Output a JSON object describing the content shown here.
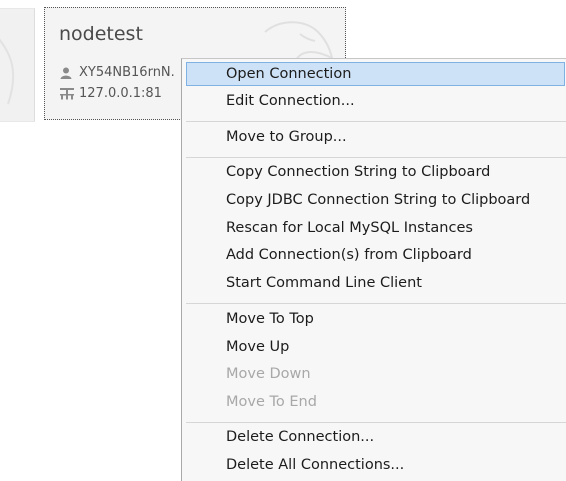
{
  "connection_tile": {
    "name": "nodetest",
    "user": "XY54NB16rnN.",
    "host": "127.0.0.1:81"
  },
  "context_menu": {
    "open_connection": "Open Connection",
    "edit_connection": "Edit Connection...",
    "move_to_group": "Move to Group...",
    "copy_connection_string": "Copy Connection String to Clipboard",
    "copy_jdbc_string": "Copy JDBC Connection String to Clipboard",
    "rescan_local": "Rescan for Local MySQL Instances",
    "add_from_clipboard": "Add Connection(s) from Clipboard",
    "start_cli": "Start Command Line Client",
    "move_to_top": "Move To Top",
    "move_up": "Move Up",
    "move_down": "Move Down",
    "move_to_end": "Move To End",
    "delete_connection": "Delete Connection...",
    "delete_all": "Delete All Connections..."
  },
  "icons": {
    "user": "user-icon",
    "host": "network-icon",
    "background": "dolphin-watermark-icon"
  },
  "colors": {
    "highlight_bg": "#cde2f6",
    "highlight_border": "#7fb1e3",
    "menu_bg": "#f7f7f7",
    "disabled_text": "#a8a8a8",
    "tile_bg": "#f4f4f4"
  }
}
